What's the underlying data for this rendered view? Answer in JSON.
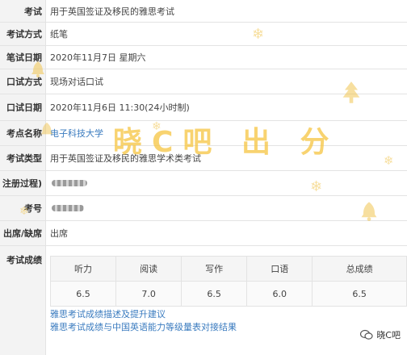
{
  "rows": [
    {
      "key": "exam",
      "label": "考试",
      "value": "用于英国签证及移民的雅思考试"
    },
    {
      "key": "written_method",
      "label": "考试方式",
      "value": "纸笔"
    },
    {
      "key": "written_date",
      "label": "笔试日期",
      "value": "2020年11月7日 星期六"
    },
    {
      "key": "speaking_method",
      "label": "口试方式",
      "value": "现场对话口试"
    },
    {
      "key": "speaking_date",
      "label": "口试日期",
      "value": "2020年11月6日 11:30(24小时制)"
    },
    {
      "key": "venue",
      "label": "考点名称",
      "value": "电子科技大学"
    },
    {
      "key": "type",
      "label": "考试类型",
      "value": "用于英国签证及移民的雅思学术类考试"
    },
    {
      "key": "registration",
      "label": "注册过程)",
      "value": ""
    },
    {
      "key": "candidate_number",
      "label": "考号",
      "value": ""
    },
    {
      "key": "attendance",
      "label": "出席/缺席",
      "value": "出席"
    }
  ],
  "scores": {
    "label": "考试成绩",
    "headers": [
      "听力",
      "阅读",
      "写作",
      "口语",
      "总成绩"
    ],
    "values": [
      "6.5",
      "7.0",
      "6.5",
      "6.0",
      "6.5"
    ]
  },
  "links": {
    "descriptors": "雅思考试成绩描述及提升建议",
    "cefr": "雅思考试成绩与中国英语能力等级量表对接结果"
  },
  "watermark": {
    "text": "晓C吧 出 分",
    "tag": "晓C吧",
    "color": "#f6c748"
  },
  "colors": {
    "label_bg": "#f3f3f3",
    "link": "#3a7bbf",
    "border": "#e3e3e3"
  }
}
